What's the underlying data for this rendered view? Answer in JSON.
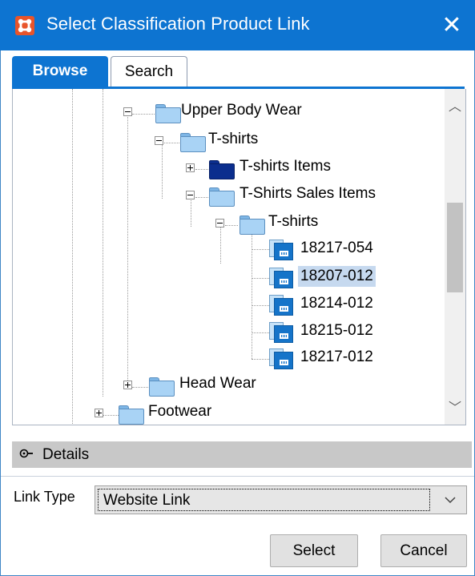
{
  "window": {
    "title": "Select Classification Product Link",
    "close_glyph": "✕",
    "app_icon": "stibo-grid-icon",
    "title_bar_color": "#0d74d1"
  },
  "tabs": [
    {
      "label": "Browse",
      "active": true
    },
    {
      "label": "Search",
      "active": false
    }
  ],
  "tree": {
    "nodes": [
      {
        "label": "Upper Body Wear",
        "icon": "folder-icon",
        "expander": "collapse"
      },
      {
        "label": "T-shirts",
        "icon": "folder-icon",
        "expander": "collapse"
      },
      {
        "label": "T-shirts Items",
        "icon": "folder-dark-icon",
        "expander": "expand"
      },
      {
        "label": "T-Shirts Sales Items",
        "icon": "folder-icon",
        "expander": "collapse"
      },
      {
        "label": "T-shirts",
        "icon": "folder-icon",
        "expander": "collapse"
      },
      {
        "label": "18217-054",
        "icon": "product-icon"
      },
      {
        "label": "18207-012",
        "icon": "product-icon",
        "selected": true
      },
      {
        "label": "18214-012",
        "icon": "product-icon"
      },
      {
        "label": "18215-012",
        "icon": "product-icon"
      },
      {
        "label": "18217-012",
        "icon": "product-icon"
      },
      {
        "label": "Head Wear",
        "icon": "folder-icon",
        "expander": "expand"
      },
      {
        "label": "Footwear",
        "icon": "folder-icon",
        "expander": "expand"
      }
    ],
    "selection_color": "#c6d9ef"
  },
  "scrollbar": {
    "up_glyph": "︿",
    "down_glyph": "﹀"
  },
  "details": {
    "label": "Details",
    "icon": "expand-details-icon"
  },
  "link_type": {
    "label": "Link Type",
    "value": "Website Link"
  },
  "buttons": {
    "select": "Select",
    "cancel": "Cancel"
  }
}
